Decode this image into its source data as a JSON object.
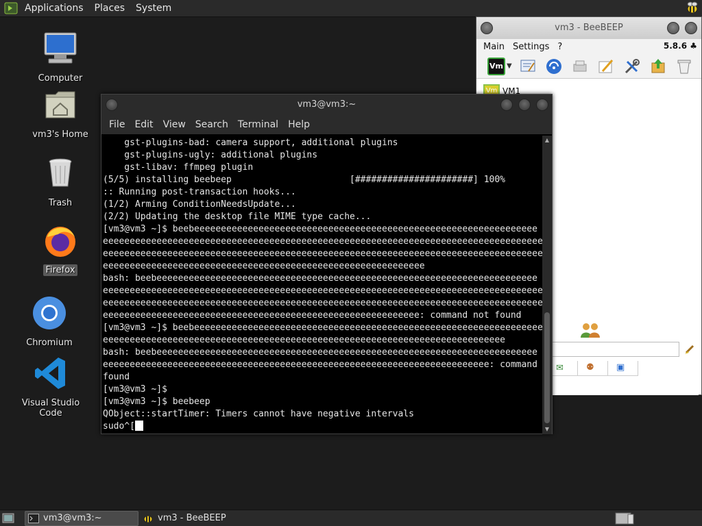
{
  "top_panel": {
    "menus": [
      "Applications",
      "Places",
      "System"
    ]
  },
  "desktop": {
    "icons": [
      {
        "label": "Computer",
        "icon": "computer-icon"
      },
      {
        "label": "vm3's Home",
        "icon": "home-folder-icon"
      },
      {
        "label": "Trash",
        "icon": "trash-icon"
      },
      {
        "label": "Firefox",
        "icon": "firefox-icon",
        "selected": true
      },
      {
        "label": "Chromium",
        "icon": "chromium-icon"
      },
      {
        "label": "Visual Studio Code",
        "icon": "vscode-icon"
      }
    ]
  },
  "beebeep": {
    "title": "vm3 - BeeBEEP",
    "menus": [
      "Main",
      "Settings",
      "?"
    ],
    "version": "5.8.6",
    "toolbar_icons": [
      "vm-status-icon",
      "dropdown-icon",
      "chat-edit-icon",
      "network-icon",
      "print-icon",
      "write-icon",
      "tools-icon",
      "update-icon",
      "trash-icon"
    ],
    "user": {
      "avatar": "Vm",
      "name": "VM1"
    }
  },
  "terminal": {
    "title": "vm3@vm3:~",
    "menus": [
      "File",
      "Edit",
      "View",
      "Search",
      "Terminal",
      "Help"
    ],
    "lines": [
      "    gst-plugins-bad: camera support, additional plugins",
      "    gst-plugins-ugly: additional plugins",
      "    gst-libav: ffmpeg plugin",
      "(5/5) installing beebeep                      [######################] 100%",
      ":: Running post-transaction hooks...",
      "(1/2) Arming ConditionNeedsUpdate...",
      "(2/2) Updating the desktop file MIME type cache...",
      "[vm3@vm3 ~]$ beebeeeeeeeeeeeeeeeeeeeeeeeeeeeeeeeeeeeeeeeeeeeeeeeeeeeeeeeeeeeeeeee",
      "eeeeeeeeeeeeeeeeeeeeeeeeeeeeeeeeeeeeeeeeeeeeeeeeeeeeeeeeeeeeeeeeeeeeeeeeeeeeeeeeeeeeeeeeee",
      "eeeeeeeeeeeeeeeeeeeeeeeeeeeeeeeeeeeeeeeeeeeeeeeeeeeeeeeeeeeeeeeeeeeeeeeeeeeeeeeeeeeeeeeeee",
      "eeeeeeeeeeeeeeeeeeeeeeeeeeeeeeeeeeeeeeeeeeeeeeeeeeeeeeeeeeee",
      "bash: beebeeeeeeeeeeeeeeeeeeeeeeeeeeeeeeeeeeeeeeeeeeeeeeeeeeeeeeeeeeeeeeeeeeeeeee",
      "eeeeeeeeeeeeeeeeeeeeeeeeeeeeeeeeeeeeeeeeeeeeeeeeeeeeeeeeeeeeeeeeeeeeeeeeeeeeeeeeeeeeeeeeee",
      "eeeeeeeeeeeeeeeeeeeeeeeeeeeeeeeeeeeeeeeeeeeeeeeeeeeeeeeeeeeeeeeeeeeeeeeeeeeeeeeeeeeeeeeeee",
      "eeeeeeeeeeeeeeeeeeeeeeeeeeeeeeeeeeeeeeeeeeeeeeeeeeeeeeeeeee: command not found",
      "[vm3@vm3 ~]$ beebeeeeeeeeeeeeeeeeeeeeeeeeeeeeeeeeeeeeeeeeeeeeeeeeeeeeeeeeeeeeeeeee",
      "eeeeeeeeeeeeeeeeeeeeeeeeeeeeeeeeeeeeeeeeeeeeeeeeeeeeeeeeeeeeeeeeeeeeeeeeeee",
      "bash: beebeeeeeeeeeeeeeeeeeeeeeeeeeeeeeeeeeeeeeeeeeeeeeeeeeeeeeeeeeeeeeeeeeeeeeee",
      "eeeeeeeeeeeeeeeeeeeeeeeeeeeeeeeeeeeeeeeeeeeeeeeeeeeeeeeeeeeeeeeeeeeeeeee: command not",
      "found",
      "[vm3@vm3 ~]$",
      "[vm3@vm3 ~]$ beebeep",
      "QObject::startTimer: Timers cannot have negative intervals"
    ],
    "prompt_line": "sudo^["
  },
  "taskbar": {
    "tasks": [
      {
        "label": "vm3@vm3:~",
        "active": true
      },
      {
        "label": "vm3 - BeeBEEP",
        "active": false
      }
    ]
  }
}
